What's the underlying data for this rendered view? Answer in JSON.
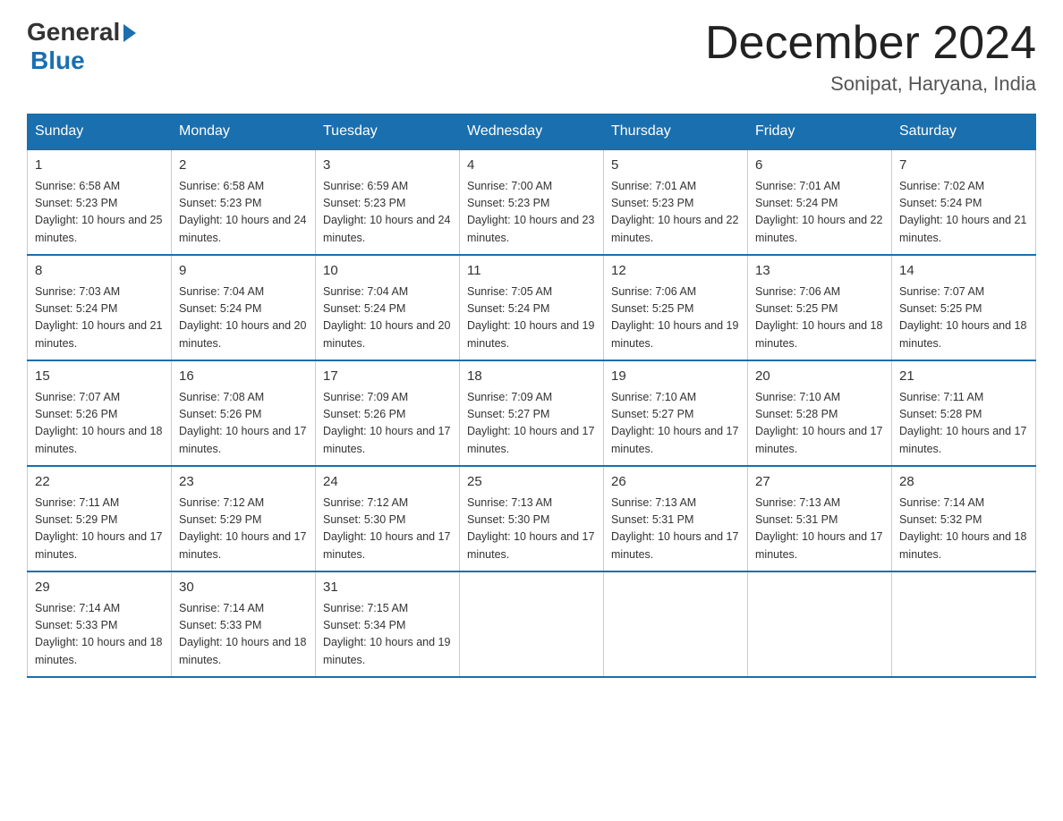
{
  "logo": {
    "general": "General",
    "blue": "Blue"
  },
  "title": "December 2024",
  "location": "Sonipat, Haryana, India",
  "days_header": [
    "Sunday",
    "Monday",
    "Tuesday",
    "Wednesday",
    "Thursday",
    "Friday",
    "Saturday"
  ],
  "weeks": [
    [
      {
        "day": "1",
        "sunrise": "6:58 AM",
        "sunset": "5:23 PM",
        "daylight": "10 hours and 25 minutes."
      },
      {
        "day": "2",
        "sunrise": "6:58 AM",
        "sunset": "5:23 PM",
        "daylight": "10 hours and 24 minutes."
      },
      {
        "day": "3",
        "sunrise": "6:59 AM",
        "sunset": "5:23 PM",
        "daylight": "10 hours and 24 minutes."
      },
      {
        "day": "4",
        "sunrise": "7:00 AM",
        "sunset": "5:23 PM",
        "daylight": "10 hours and 23 minutes."
      },
      {
        "day": "5",
        "sunrise": "7:01 AM",
        "sunset": "5:23 PM",
        "daylight": "10 hours and 22 minutes."
      },
      {
        "day": "6",
        "sunrise": "7:01 AM",
        "sunset": "5:24 PM",
        "daylight": "10 hours and 22 minutes."
      },
      {
        "day": "7",
        "sunrise": "7:02 AM",
        "sunset": "5:24 PM",
        "daylight": "10 hours and 21 minutes."
      }
    ],
    [
      {
        "day": "8",
        "sunrise": "7:03 AM",
        "sunset": "5:24 PM",
        "daylight": "10 hours and 21 minutes."
      },
      {
        "day": "9",
        "sunrise": "7:04 AM",
        "sunset": "5:24 PM",
        "daylight": "10 hours and 20 minutes."
      },
      {
        "day": "10",
        "sunrise": "7:04 AM",
        "sunset": "5:24 PM",
        "daylight": "10 hours and 20 minutes."
      },
      {
        "day": "11",
        "sunrise": "7:05 AM",
        "sunset": "5:24 PM",
        "daylight": "10 hours and 19 minutes."
      },
      {
        "day": "12",
        "sunrise": "7:06 AM",
        "sunset": "5:25 PM",
        "daylight": "10 hours and 19 minutes."
      },
      {
        "day": "13",
        "sunrise": "7:06 AM",
        "sunset": "5:25 PM",
        "daylight": "10 hours and 18 minutes."
      },
      {
        "day": "14",
        "sunrise": "7:07 AM",
        "sunset": "5:25 PM",
        "daylight": "10 hours and 18 minutes."
      }
    ],
    [
      {
        "day": "15",
        "sunrise": "7:07 AM",
        "sunset": "5:26 PM",
        "daylight": "10 hours and 18 minutes."
      },
      {
        "day": "16",
        "sunrise": "7:08 AM",
        "sunset": "5:26 PM",
        "daylight": "10 hours and 17 minutes."
      },
      {
        "day": "17",
        "sunrise": "7:09 AM",
        "sunset": "5:26 PM",
        "daylight": "10 hours and 17 minutes."
      },
      {
        "day": "18",
        "sunrise": "7:09 AM",
        "sunset": "5:27 PM",
        "daylight": "10 hours and 17 minutes."
      },
      {
        "day": "19",
        "sunrise": "7:10 AM",
        "sunset": "5:27 PM",
        "daylight": "10 hours and 17 minutes."
      },
      {
        "day": "20",
        "sunrise": "7:10 AM",
        "sunset": "5:28 PM",
        "daylight": "10 hours and 17 minutes."
      },
      {
        "day": "21",
        "sunrise": "7:11 AM",
        "sunset": "5:28 PM",
        "daylight": "10 hours and 17 minutes."
      }
    ],
    [
      {
        "day": "22",
        "sunrise": "7:11 AM",
        "sunset": "5:29 PM",
        "daylight": "10 hours and 17 minutes."
      },
      {
        "day": "23",
        "sunrise": "7:12 AM",
        "sunset": "5:29 PM",
        "daylight": "10 hours and 17 minutes."
      },
      {
        "day": "24",
        "sunrise": "7:12 AM",
        "sunset": "5:30 PM",
        "daylight": "10 hours and 17 minutes."
      },
      {
        "day": "25",
        "sunrise": "7:13 AM",
        "sunset": "5:30 PM",
        "daylight": "10 hours and 17 minutes."
      },
      {
        "day": "26",
        "sunrise": "7:13 AM",
        "sunset": "5:31 PM",
        "daylight": "10 hours and 17 minutes."
      },
      {
        "day": "27",
        "sunrise": "7:13 AM",
        "sunset": "5:31 PM",
        "daylight": "10 hours and 17 minutes."
      },
      {
        "day": "28",
        "sunrise": "7:14 AM",
        "sunset": "5:32 PM",
        "daylight": "10 hours and 18 minutes."
      }
    ],
    [
      {
        "day": "29",
        "sunrise": "7:14 AM",
        "sunset": "5:33 PM",
        "daylight": "10 hours and 18 minutes."
      },
      {
        "day": "30",
        "sunrise": "7:14 AM",
        "sunset": "5:33 PM",
        "daylight": "10 hours and 18 minutes."
      },
      {
        "day": "31",
        "sunrise": "7:15 AM",
        "sunset": "5:34 PM",
        "daylight": "10 hours and 19 minutes."
      },
      null,
      null,
      null,
      null
    ]
  ]
}
